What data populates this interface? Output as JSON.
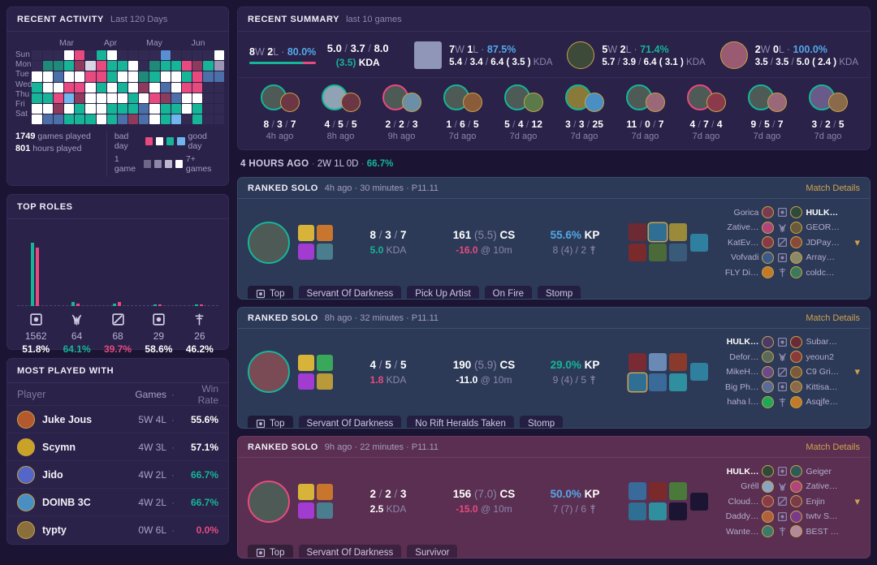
{
  "recent_activity": {
    "title": "RECENT ACTIVITY",
    "subtitle": "Last 120 Days",
    "months": [
      "Mar",
      "Apr",
      "May",
      "Jun"
    ],
    "days": [
      "Sun",
      "Mon",
      "Tue",
      "Wed",
      "Thu",
      "Fri",
      "Sat"
    ],
    "grid": [
      [
        0,
        0,
        0,
        3,
        1,
        0,
        5,
        3,
        0,
        0,
        0,
        0,
        7,
        0,
        0,
        0,
        0,
        3
      ],
      [
        0,
        6,
        6,
        5,
        2,
        4,
        1,
        5,
        5,
        3,
        0,
        6,
        5,
        5,
        1,
        2,
        5,
        10
      ],
      [
        3,
        3,
        8,
        3,
        3,
        1,
        1,
        5,
        3,
        3,
        6,
        5,
        3,
        3,
        5,
        1,
        8,
        8
      ],
      [
        5,
        3,
        3,
        1,
        1,
        3,
        5,
        3,
        5,
        3,
        2,
        3,
        8,
        3,
        1,
        1,
        0,
        0
      ],
      [
        5,
        5,
        1,
        9,
        2,
        3,
        3,
        3,
        3,
        5,
        3,
        1,
        2,
        8,
        3,
        3,
        0,
        0
      ],
      [
        3,
        3,
        2,
        3,
        5,
        3,
        3,
        5,
        5,
        5,
        8,
        3,
        5,
        5,
        3,
        5,
        0,
        0
      ],
      [
        3,
        8,
        8,
        5,
        5,
        5,
        3,
        5,
        8,
        2,
        8,
        3,
        5,
        9,
        0,
        5,
        0,
        0
      ]
    ],
    "games_played_value": "1749",
    "games_played_label": "games played",
    "hours_played_value": "801",
    "hours_played_label": "hours played",
    "legend_bad": "bad day",
    "legend_good": "good day",
    "legend_one": "1 game",
    "legend_many": "7+ games"
  },
  "top_roles": {
    "title": "TOP ROLES",
    "columns": [
      {
        "role": "top",
        "games": "1562",
        "winrate": "51.8%",
        "wr_color": "#ffffff",
        "win_h": 78,
        "loss_h": 72
      },
      {
        "role": "jungle",
        "games": "64",
        "winrate": "64.1%",
        "wr_color": "#16b598",
        "win_h": 5,
        "loss_h": 3
      },
      {
        "role": "mid",
        "games": "68",
        "winrate": "39.7%",
        "wr_color": "#e84a7f",
        "win_h": 3,
        "loss_h": 5
      },
      {
        "role": "adc",
        "games": "29",
        "winrate": "58.6%",
        "wr_color": "#ffffff",
        "win_h": 2,
        "loss_h": 2
      },
      {
        "role": "support",
        "games": "26",
        "winrate": "46.2%",
        "wr_color": "#ffffff",
        "win_h": 2,
        "loss_h": 2
      }
    ]
  },
  "most_played_with": {
    "title": "MOST PLAYED WITH",
    "headers": {
      "player": "Player",
      "games": "Games",
      "dot": "·",
      "winrate": "Win Rate"
    },
    "rows": [
      {
        "name": "Juke Jous",
        "games": "5W 4L",
        "winrate": "55.6%",
        "wr_color": "#ffffff",
        "avatar": "#b4582e"
      },
      {
        "name": "Scymn",
        "games": "4W 3L",
        "winrate": "57.1%",
        "wr_color": "#ffffff",
        "avatar": "#c9a227"
      },
      {
        "name": "Jido",
        "games": "4W 2L",
        "winrate": "66.7%",
        "wr_color": "#16b598",
        "avatar": "#5566c9"
      },
      {
        "name": "DOINB 3C",
        "games": "4W 2L",
        "winrate": "66.7%",
        "wr_color": "#16b598",
        "avatar": "#4a8fc4"
      },
      {
        "name": "typty",
        "games": "0W 6L",
        "winrate": "0.0%",
        "wr_color": "#e84a7f",
        "avatar": "#8a6f3d"
      }
    ]
  },
  "recent_summary": {
    "title": "RECENT SUMMARY",
    "subtitle": "last 10 games",
    "overall": {
      "wins": "8",
      "w": "W",
      "losses": "2",
      "l": "L",
      "dot": "·",
      "winrate": "80.0%",
      "bar_win_pct": 80
    },
    "kda": {
      "kills": "5.0",
      "deaths": "3.7",
      "assists": "8.0",
      "ratio": "(3.5)",
      "label": "KDA"
    },
    "champions": [
      {
        "record": "7W 1L",
        "wins": "7",
        "losses": "1",
        "winrate": "87.5%",
        "wr_color": "#53a8e8",
        "kills": "5.4",
        "deaths": "3.4",
        "assists": "6.4",
        "ratio": "( 3.5 )",
        "label": "KDA",
        "portrait": "#8f96b8",
        "shape": "square"
      },
      {
        "record": "5W 2L",
        "wins": "5",
        "losses": "2",
        "winrate": "71.4%",
        "wr_color": "#16b598",
        "kills": "5.7",
        "deaths": "3.9",
        "assists": "6.4",
        "ratio": "( 3.1 )",
        "label": "KDA",
        "portrait": "#3d4a3a",
        "shape": "circle"
      },
      {
        "record": "2W 0L",
        "wins": "2",
        "losses": "0",
        "winrate": "100.0%",
        "wr_color": "#53a8e8",
        "kills": "3.5",
        "deaths": "3.5",
        "assists": "5.0",
        "ratio": "( 2.4 )",
        "label": "KDA",
        "portrait": "#9a5a72",
        "shape": "circle"
      }
    ],
    "games": [
      {
        "k": "8",
        "d": "3",
        "a": "7",
        "ago": "4h ago",
        "result": "win",
        "c1": "#4e5a55",
        "c2": "#6d3644"
      },
      {
        "k": "4",
        "d": "5",
        "a": "5",
        "ago": "8h ago",
        "result": "win",
        "c1": "#8fa3b5",
        "c2": "#6d3644"
      },
      {
        "k": "2",
        "d": "2",
        "a": "3",
        "ago": "9h ago",
        "result": "loss",
        "c1": "#4e5a55",
        "c2": "#6a8fa6"
      },
      {
        "k": "1",
        "d": "6",
        "a": "5",
        "ago": "7d ago",
        "result": "win",
        "c1": "#4e5a55",
        "c2": "#8a5c3a"
      },
      {
        "k": "5",
        "d": "4",
        "a": "12",
        "ago": "7d ago",
        "result": "win",
        "c1": "#4e5a55",
        "c2": "#5a7a4a"
      },
      {
        "k": "3",
        "d": "3",
        "a": "25",
        "ago": "7d ago",
        "result": "win",
        "c1": "#8a7a3a",
        "c2": "#4a8fc4"
      },
      {
        "k": "11",
        "d": "0",
        "a": "7",
        "ago": "7d ago",
        "result": "win",
        "c1": "#4e5a55",
        "c2": "#9a6878"
      },
      {
        "k": "4",
        "d": "7",
        "a": "4",
        "ago": "7d ago",
        "result": "loss",
        "c1": "#4e5a55",
        "c2": "#8a3a4a"
      },
      {
        "k": "9",
        "d": "5",
        "a": "7",
        "ago": "7d ago",
        "result": "win",
        "c1": "#4e5a55",
        "c2": "#9a6878"
      },
      {
        "k": "3",
        "d": "2",
        "a": "5",
        "ago": "7d ago",
        "result": "win",
        "c1": "#6a5a8a",
        "c2": "#8a6a4a"
      }
    ]
  },
  "day_header": {
    "when": "4 HOURS AGO",
    "dot1": "·",
    "record": "2W 1L 0D",
    "dot2": "·",
    "winrate": "66.7%"
  },
  "matches": [
    {
      "result": "win",
      "queue": "RANKED SOLO",
      "meta": "4h ago · 30 minutes · P11.11",
      "details_label": "Match Details",
      "kills": "8",
      "deaths": "3",
      "assists": "7",
      "kda": "5.0",
      "kda_label": "KDA",
      "kda_color": "#16b598",
      "cs": "161",
      "cspm": "(5.5)",
      "cs_label": "CS",
      "csdiff": "-16.0",
      "csdiff_label": "@ 10m",
      "csdiff_color": "#e84a7f",
      "kp": "55.6%",
      "kp_label": "KP",
      "kp_color": "#53a8e8",
      "vision": "8 (4) / 2",
      "champ_color": "#4e5a55",
      "spells": [
        "#d8b33a",
        "#c8762e",
        "#a23bd0",
        "#4a7e8f"
      ],
      "items": [
        "#6e2a33",
        "#2f6f93",
        "#9a8a3a",
        "#7a2a2a",
        "#4a6a3a",
        "#3a5a7a"
      ],
      "item_highlight": 1,
      "trinket": "#2f7f9f",
      "tags": [
        {
          "label": "Top",
          "icon": "role-top"
        },
        {
          "label": "Servant Of Darkness"
        },
        {
          "label": "Pick Up Artist"
        },
        {
          "label": "On Fire"
        },
        {
          "label": "Stomp"
        }
      ],
      "team_left": [
        {
          "name": "Gorica",
          "color": "#7a3a52",
          "role": "top"
        },
        {
          "name": "Zative…",
          "color": "#b0457a",
          "role": "jungle"
        },
        {
          "name": "KatEv…",
          "color": "#8a3a46",
          "role": "mid"
        },
        {
          "name": "Vofvadi",
          "color": "#3a5a8a",
          "role": "adc"
        },
        {
          "name": "FLY Di…",
          "color": "#c07a2a",
          "role": "support"
        }
      ],
      "team_right": [
        {
          "name": "HULK…",
          "color": "#2f4a3a",
          "me": true
        },
        {
          "name": "GEOR…",
          "color": "#6a5a3a"
        },
        {
          "name": "JDPay…",
          "color": "#8a4a3a"
        },
        {
          "name": "Array…",
          "color": "#8a8a6a"
        },
        {
          "name": "coldc…",
          "color": "#3a7a5a"
        }
      ]
    },
    {
      "result": "win",
      "queue": "RANKED SOLO",
      "meta": "8h ago · 32 minutes · P11.11",
      "details_label": "Match Details",
      "kills": "4",
      "deaths": "5",
      "assists": "5",
      "kda": "1.8",
      "kda_label": "KDA",
      "kda_color": "#e84a7f",
      "cs": "190",
      "cspm": "(5.9)",
      "cs_label": "CS",
      "csdiff": "-11.0",
      "csdiff_label": "@ 10m",
      "csdiff_color": "#ffffff",
      "kp": "29.0%",
      "kp_label": "KP",
      "kp_color": "#16b598",
      "vision": "9 (4) / 5",
      "champ_color": "#7a4a55",
      "spells": [
        "#d8b33a",
        "#3aa85a",
        "#a23bd0",
        "#b89a3a"
      ],
      "items": [
        "#7a2a33",
        "#6a8ab5",
        "#8a3a2a",
        "#2f6f93",
        "#3a6a9a",
        "#2f8f9f"
      ],
      "item_highlight": 3,
      "trinket": "#2f7f9f",
      "tags": [
        {
          "label": "Top",
          "icon": "role-top"
        },
        {
          "label": "Servant Of Darkness"
        },
        {
          "label": "No Rift Heralds Taken"
        },
        {
          "label": "Stomp"
        }
      ],
      "team_left": [
        {
          "name": "HULK…",
          "color": "#4a3a6a",
          "me": true,
          "role": "top"
        },
        {
          "name": "Defor…",
          "color": "#5a6a5a",
          "role": "jungle"
        },
        {
          "name": "MikeH…",
          "color": "#6a4a8a",
          "role": "mid"
        },
        {
          "name": "Big Ph…",
          "color": "#5a6a9a",
          "role": "adc"
        },
        {
          "name": "haha l…",
          "color": "#1ea85a",
          "role": "support"
        }
      ],
      "team_right": [
        {
          "name": "Subar…",
          "color": "#6a2a3a"
        },
        {
          "name": "yeoun2",
          "color": "#8a3a3a"
        },
        {
          "name": "C9 Gri…",
          "color": "#7a5a3a"
        },
        {
          "name": "Kittisa…",
          "color": "#8a6a4a"
        },
        {
          "name": "Asqjfe…",
          "color": "#c07a2a"
        }
      ]
    },
    {
      "result": "loss",
      "queue": "RANKED SOLO",
      "meta": "9h ago · 22 minutes · P11.11",
      "details_label": "Match Details",
      "kills": "2",
      "deaths": "2",
      "assists": "3",
      "kda": "2.5",
      "kda_label": "KDA",
      "kda_color": "#ffffff",
      "cs": "156",
      "cspm": "(7.0)",
      "cs_label": "CS",
      "csdiff": "-15.0",
      "csdiff_label": "@ 10m",
      "csdiff_color": "#e84a7f",
      "kp": "50.0%",
      "kp_label": "KP",
      "kp_color": "#53a8e8",
      "vision": "7 (7) / 6",
      "champ_color": "#4e5a55",
      "spells": [
        "#d8b33a",
        "#c8762e",
        "#a23bd0",
        "#4a7e8f"
      ],
      "items": [
        "#3a6a9a",
        "#7a2a2a",
        "#4a7a3a",
        "#2f6f93",
        "#2f8f9f",
        "#1b1533"
      ],
      "item_highlight": -1,
      "trinket": "#1b1533",
      "tags": [
        {
          "label": "Top",
          "icon": "role-top"
        },
        {
          "label": "Servant Of Darkness"
        },
        {
          "label": "Survivor"
        }
      ],
      "team_left": [
        {
          "name": "HULK…",
          "color": "#2f4a3a",
          "me": true,
          "role": "top"
        },
        {
          "name": "Gréll",
          "color": "#8aa5c4",
          "role": "jungle"
        },
        {
          "name": "Cloud…",
          "color": "#8a3a4a",
          "role": "mid"
        },
        {
          "name": "Daddy…",
          "color": "#b0603a",
          "role": "adc"
        },
        {
          "name": "Wante…",
          "color": "#3a7a6a",
          "role": "support"
        }
      ],
      "team_right": [
        {
          "name": "Geiger",
          "color": "#2f5a5a"
        },
        {
          "name": "Zative…",
          "color": "#b0457a"
        },
        {
          "name": "Enjin",
          "color": "#7a3a4a"
        },
        {
          "name": "twtv S…",
          "color": "#7a3a8a"
        },
        {
          "name": "BEST …",
          "color": "#b08a9a"
        }
      ]
    }
  ]
}
